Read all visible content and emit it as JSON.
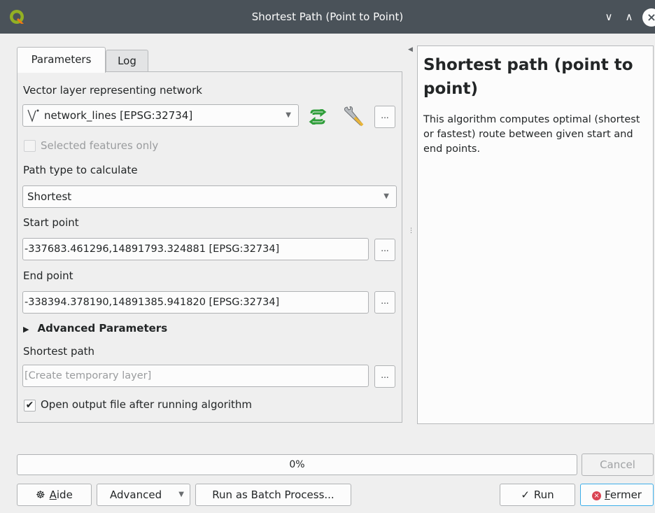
{
  "window": {
    "title": "Shortest Path (Point to Point)",
    "min_glyph": "∨",
    "max_glyph": "∧",
    "close_glyph": "×"
  },
  "tabs": [
    {
      "label": "Parameters",
      "active": true
    },
    {
      "label": "Log",
      "active": false
    }
  ],
  "params": {
    "network_label": "Vector layer representing network",
    "network_value": "network_lines [EPSG:32734]",
    "selected_only_label": "Selected features only",
    "selected_only_checked": false,
    "path_type_label": "Path type to calculate",
    "path_type_value": "Shortest",
    "start_label": "Start point",
    "start_value": "-337683.461296,14891793.324881 [EPSG:32734]",
    "end_label": "End point",
    "end_value": "-338394.378190,14891385.941820 [EPSG:32734]",
    "advanced_label": "Advanced Parameters",
    "output_label": "Shortest path",
    "output_placeholder": "[Create temporary layer]",
    "open_output_label": "Open output file after running algorithm",
    "open_output_checked": true,
    "dots_label": "...",
    "check_glyph": "✔"
  },
  "help": {
    "title": "Shortest path (point to point)",
    "description": "This algorithm computes optimal (shortest or fastest) route between given start and end points."
  },
  "progress": {
    "value": 0,
    "label": "0%"
  },
  "buttons": {
    "cancel": "Cancel",
    "help_prefix": "A",
    "help_rest": "ide",
    "advanced": "Advanced",
    "batch": "Run as Batch Process...",
    "run": "Run",
    "close_prefix": "F",
    "close_rest": "ermer"
  },
  "colors": {
    "titlebar": "#4a5259",
    "accent": "#3daee9",
    "refresh_icon": "#2f9e3a",
    "close_icon": "#da4453"
  }
}
